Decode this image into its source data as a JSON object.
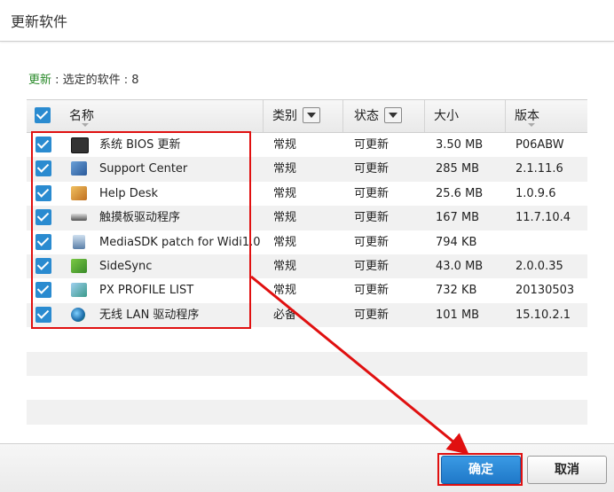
{
  "window": {
    "title": "更新软件"
  },
  "summary": {
    "label": "更新",
    "text": " : 选定的软件 : 8"
  },
  "table": {
    "headers": {
      "name": "名称",
      "category": "类别",
      "status": "状态",
      "size": "大小",
      "version": "版本"
    },
    "rows": [
      {
        "name": "系统 BIOS 更新",
        "category": "常规",
        "status": "可更新",
        "size": "3.50 MB",
        "version": "P06ABW",
        "icon": "bios-chip-icon",
        "checked": true
      },
      {
        "name": "Support Center",
        "category": "常规",
        "status": "可更新",
        "size": "285 MB",
        "version": "2.1.11.6",
        "icon": "support-center-icon",
        "checked": true
      },
      {
        "name": "Help Desk",
        "category": "常规",
        "status": "可更新",
        "size": "25.6 MB",
        "version": "1.0.9.6",
        "icon": "help-desk-icon",
        "checked": true
      },
      {
        "name": "触摸板驱动程序",
        "category": "常规",
        "status": "可更新",
        "size": "167 MB",
        "version": "11.7.10.4",
        "icon": "touchpad-icon",
        "checked": true
      },
      {
        "name": "MediaSDK patch for Widi1.0",
        "category": "常规",
        "status": "可更新",
        "size": "794 KB",
        "version": "",
        "icon": "media-sdk-icon",
        "checked": true
      },
      {
        "name": "SideSync",
        "category": "常规",
        "status": "可更新",
        "size": "43.0 MB",
        "version": "2.0.0.35",
        "icon": "sidesync-icon",
        "checked": true
      },
      {
        "name": "PX PROFILE LIST",
        "category": "常规",
        "status": "可更新",
        "size": "732 KB",
        "version": "20130503",
        "icon": "profile-list-icon",
        "checked": true
      },
      {
        "name": "无线 LAN 驱动程序",
        "category": "必备",
        "status": "可更新",
        "size": "101 MB",
        "version": "15.10.2.1",
        "icon": "wireless-lan-icon",
        "checked": true
      }
    ]
  },
  "buttons": {
    "ok": "确定",
    "cancel": "取消"
  },
  "colors": {
    "accent": "#2a8bd0",
    "highlight": "#e01010",
    "summary_label": "#2a8a2a"
  }
}
